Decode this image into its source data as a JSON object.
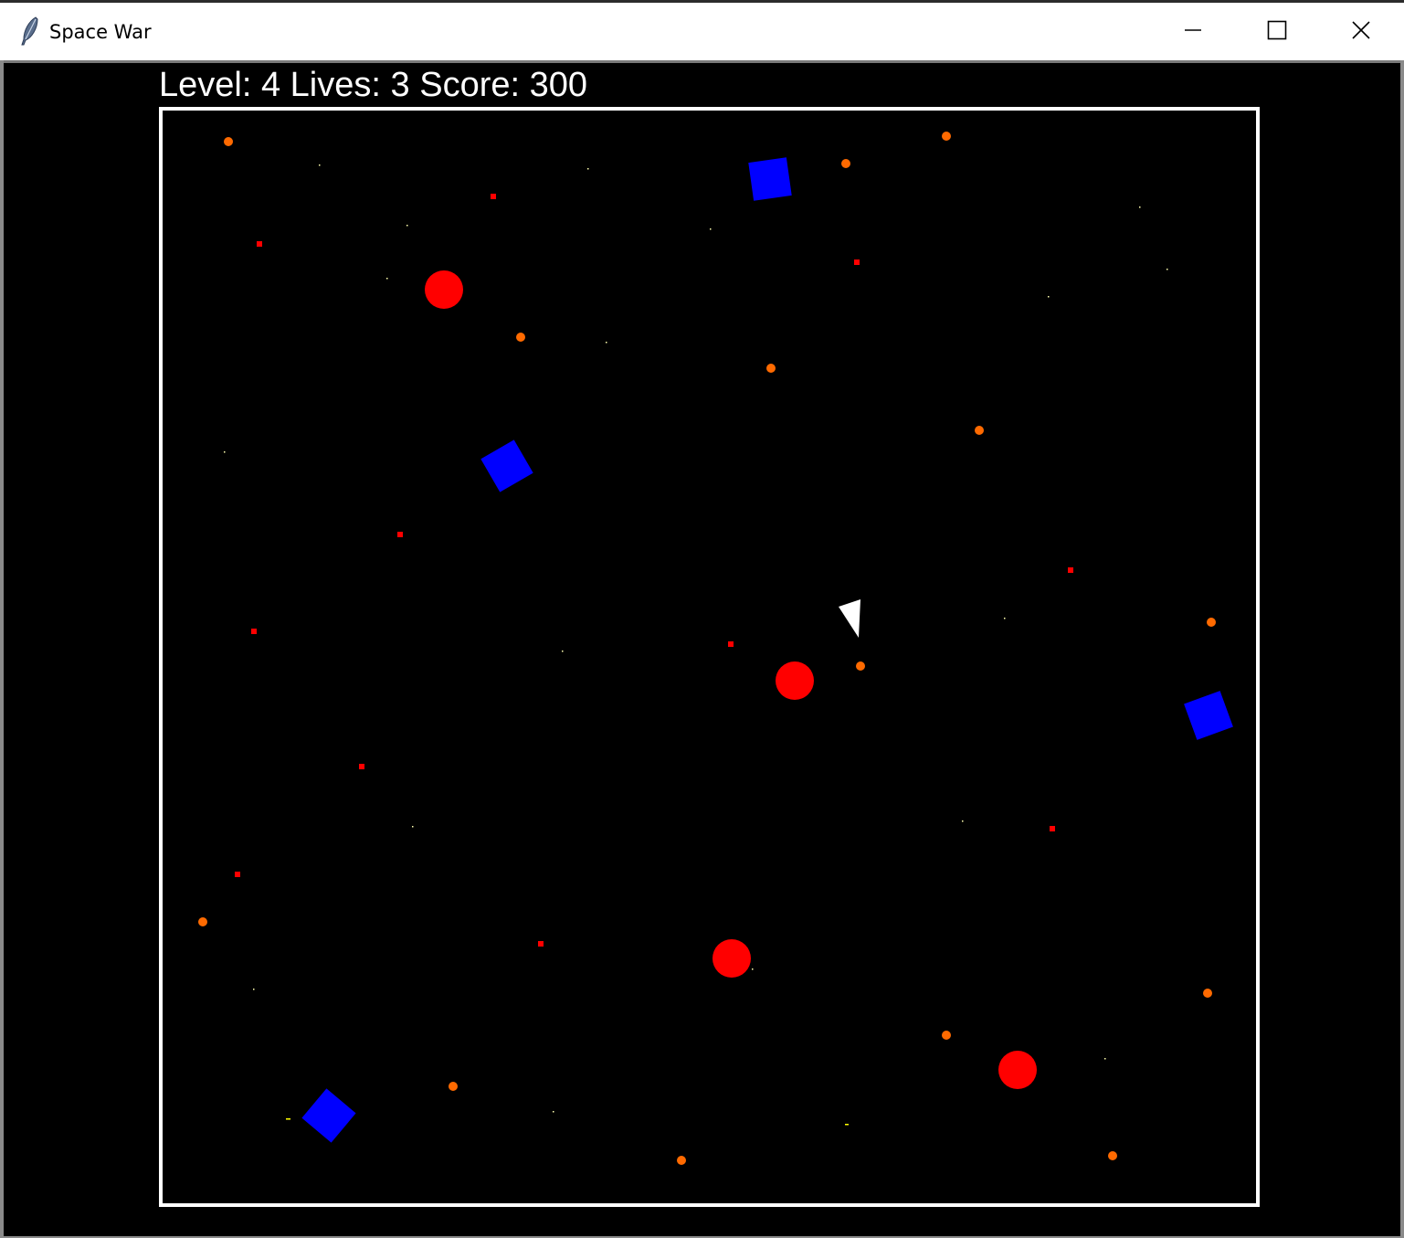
{
  "window": {
    "title": "Space War"
  },
  "hud": {
    "level_label": "Level:",
    "level_value": "4",
    "lives_label": "Lives:",
    "lives_value": "3",
    "score_label": "Score:",
    "score_value": "300"
  },
  "colors": {
    "background": "#000000",
    "border": "#ffffff",
    "enemy": "#ff0000",
    "ally": "#0000ff",
    "player": "#ffffff",
    "particle_orange": "#ff6a00",
    "particle_red": "#ff0000",
    "star": "#ffff99"
  },
  "icons": {
    "app": "feather-icon",
    "minimize": "minimize-icon",
    "maximize": "maximize-icon",
    "close": "close-icon"
  }
}
